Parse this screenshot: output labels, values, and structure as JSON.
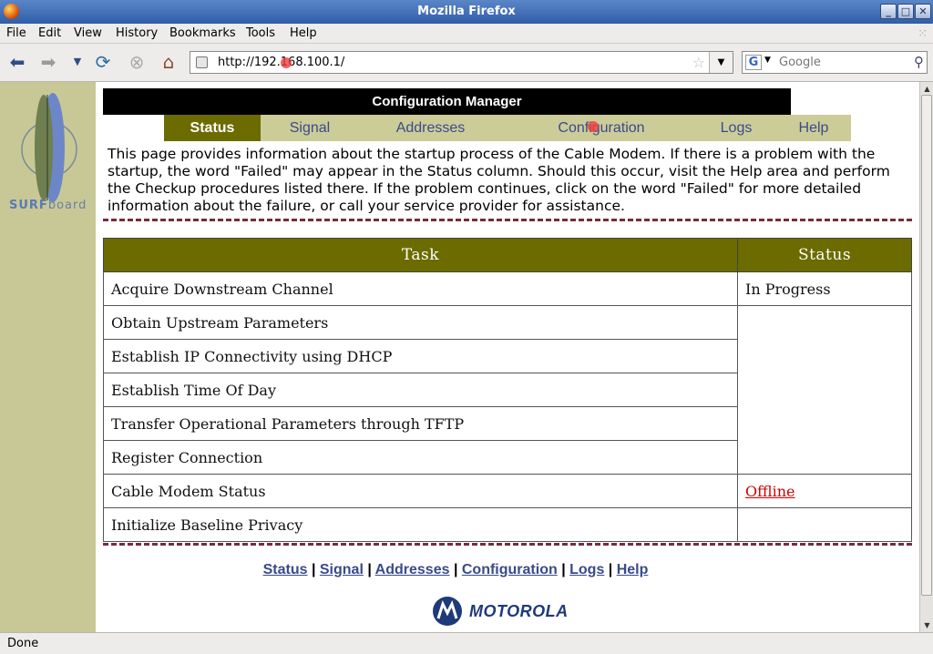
{
  "window": {
    "title": "Mozilla Firefox"
  },
  "menu": [
    "File",
    "Edit",
    "View",
    "History",
    "Bookmarks",
    "Tools",
    "Help"
  ],
  "address": {
    "url": "http://192.168.100.1/"
  },
  "search": {
    "engine_icon": "G",
    "placeholder": "Google"
  },
  "sidebar": {
    "logo_prefix": "SURF",
    "logo_suffix": "board"
  },
  "page": {
    "header": "Configuration Manager",
    "tabs": [
      "Status",
      "Signal",
      "Addresses",
      "Configuration",
      "Logs",
      "Help"
    ],
    "active_tab": "Status",
    "intro": "This page provides information about the startup process of the Cable Modem. If there is a problem with the startup, the word \"Failed\" may appear in the Status column. Should this occur, visit the Help area and perform the Checkup procedures listed there. If the problem continues, click on the word \"Failed\" for more detailed information about the failure, or call your service provider for assistance.",
    "table": {
      "headers": [
        "Task",
        "Status"
      ],
      "rows": [
        {
          "task": "Acquire Downstream Channel",
          "status": "In Progress"
        },
        {
          "task": "Obtain Upstream Parameters",
          "status": ""
        },
        {
          "task": "Establish IP Connectivity using DHCP",
          "status": ""
        },
        {
          "task": "Establish Time Of Day",
          "status": ""
        },
        {
          "task": "Transfer Operational Parameters through TFTP",
          "status": ""
        },
        {
          "task": "Register Connection",
          "status": ""
        },
        {
          "task": "Cable Modem Status",
          "status": "Offline"
        },
        {
          "task": "Initialize Baseline Privacy",
          "status": ""
        }
      ]
    },
    "footer_links": [
      "Status",
      "Signal",
      "Addresses",
      "Configuration",
      "Logs",
      "Help"
    ],
    "brand": "MOTOROLA"
  },
  "statusbar": {
    "text": "Done"
  },
  "colors": {
    "olive": "#6b6b00",
    "tab_bg": "#cccc99",
    "sidebar": "#c8c896",
    "link": "#3a4a8a",
    "offline": "#cc0000",
    "divider": "#7a2b3c"
  }
}
